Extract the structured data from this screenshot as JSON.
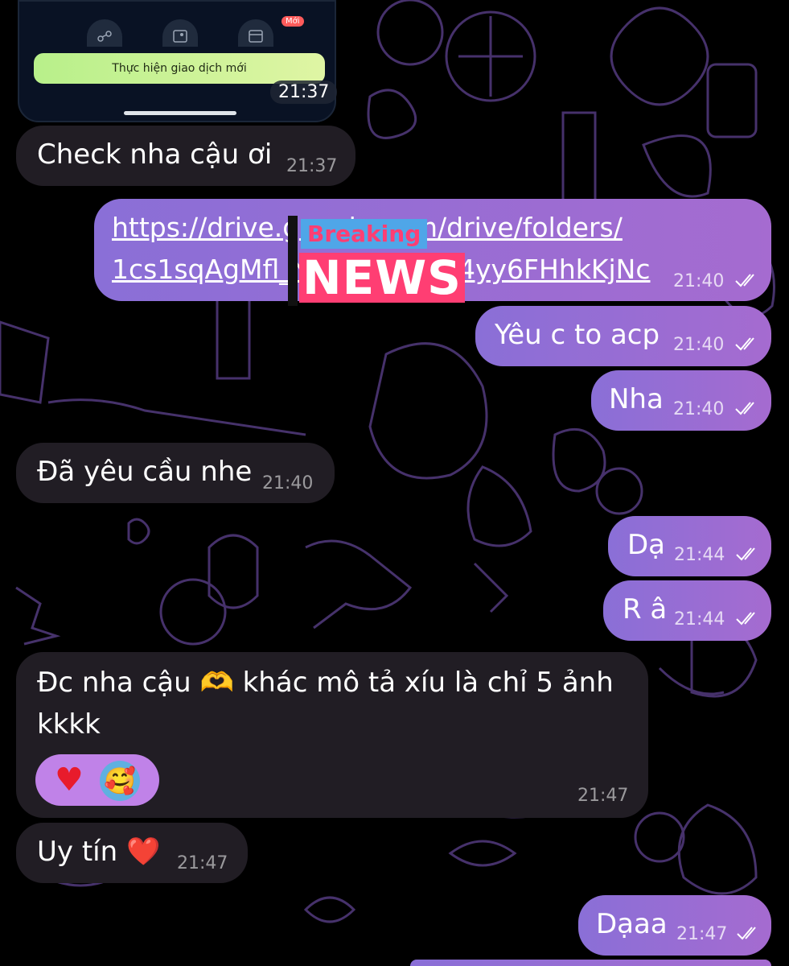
{
  "preview": {
    "button_label": "Thực hiện giao dịch mới",
    "badge": "Mới",
    "time": "21:37"
  },
  "sticker": {
    "top": "Breaking",
    "bottom": "NEWS"
  },
  "messages": [
    {
      "text": "Check nha cậu ơi",
      "time": "21:37"
    },
    {
      "line1": "https://drive.google.com/drive/folders/",
      "line2": "1cs1sqAgMfl_YqQhjX0nKR4yy6FHhkKjNc",
      "time": "21:40"
    },
    {
      "text": "Yêu c to acp",
      "time": "21:40"
    },
    {
      "text": "Nha",
      "time": "21:40"
    },
    {
      "text": "Đã yêu cầu nhe",
      "time": "21:40"
    },
    {
      "text": "Dạ",
      "time": "21:44"
    },
    {
      "text": "R â",
      "time": "21:44"
    },
    {
      "line1": "Đc nha cậu 🫶 khác mô tả xíu là chỉ 5 ảnh",
      "line2": "kkkk",
      "time": "21:47",
      "reactions": [
        "♥",
        "🥰"
      ]
    },
    {
      "text": "Uy tín ❤️",
      "time": "21:47"
    },
    {
      "text": "Dạaa",
      "time": "21:47"
    }
  ],
  "colors": {
    "incoming": "#211d24",
    "outgoing_start": "#8a6fd7",
    "outgoing_end": "#a56bd0",
    "wallpaper_pattern": "#5a3f86"
  },
  "icons": [
    "share-icon",
    "gallery-icon",
    "wallet-icon",
    "double-check-icon"
  ]
}
